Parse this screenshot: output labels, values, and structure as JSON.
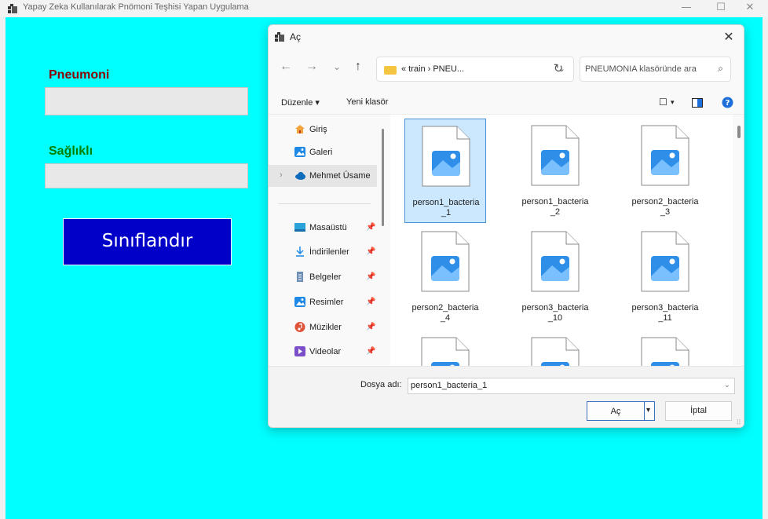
{
  "window": {
    "title": "Yapay Zeka Kullanılarak Pnömoni Teşhisi Yapan Uygulama",
    "minimize": "—",
    "maximize": "☐",
    "close": "✕"
  },
  "form": {
    "pneumonia_label": "Pneumoni",
    "pneumonia_value": "",
    "healthy_label": "Sağlıklı",
    "healthy_value": "",
    "classify_button": "Sınıflandır",
    "colors": {
      "background": "#00ffff",
      "pneumonia_label": "#8b0000",
      "healthy_label": "#008000",
      "classify_button": "#0000c8"
    }
  },
  "dialog": {
    "title": "Aç",
    "close": "✕",
    "nav": {
      "back": "←",
      "forward": "→",
      "recent": "⌄",
      "up": "↑",
      "refresh": "↻"
    },
    "address": {
      "path": "« train › PNEU...",
      "chevron": "⌄"
    },
    "search": {
      "placeholder": "PNEUMONIA klasöründe ara",
      "icon": "⌕"
    },
    "commands": {
      "organize": "Düzenle ▾",
      "new_folder": "Yeni klasör",
      "view": "☐",
      "view_arrow": "▾",
      "preview": "▣",
      "help": "?"
    },
    "nav_pane": [
      {
        "label": "Giriş",
        "icon": "home-icon",
        "pinned": false
      },
      {
        "label": "Galeri",
        "icon": "gallery-icon",
        "pinned": false
      },
      {
        "label": "Mehmet Üsame",
        "icon": "cloud-icon",
        "pinned": false,
        "expander": "›"
      },
      {
        "label": "Masaüstü",
        "icon": "desktop-icon",
        "pinned": true
      },
      {
        "label": "İndirilenler",
        "icon": "download-icon",
        "pinned": true
      },
      {
        "label": "Belgeler",
        "icon": "documents-icon",
        "pinned": true
      },
      {
        "label": "Resimler",
        "icon": "pictures-icon",
        "pinned": true
      },
      {
        "label": "Müzikler",
        "icon": "music-icon",
        "pinned": true
      },
      {
        "label": "Videolar",
        "icon": "videos-icon",
        "pinned": true
      }
    ],
    "pin_glyph": "📌",
    "files": [
      {
        "name": "person1_bacteria_1",
        "selected": true
      },
      {
        "name": "person1_bacteria_2",
        "selected": false
      },
      {
        "name": "person2_bacteria_3",
        "selected": false
      },
      {
        "name": "person2_bacteria_4",
        "selected": false
      },
      {
        "name": "person3_bacteria_10",
        "selected": false
      },
      {
        "name": "person3_bacteria_11",
        "selected": false
      },
      {
        "name": "",
        "selected": false
      },
      {
        "name": "",
        "selected": false
      },
      {
        "name": "",
        "selected": false
      }
    ],
    "file_name_label": "Dosya adı:",
    "file_name_value": "person1_bacteria_1",
    "open_button": "Aç",
    "cancel_button": "İptal"
  }
}
